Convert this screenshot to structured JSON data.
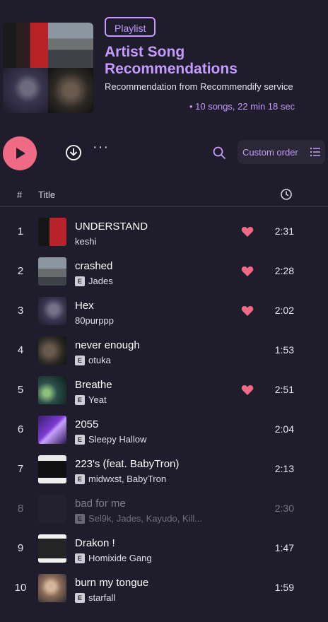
{
  "playlist": {
    "badge": "Playlist",
    "title": "Artist Song Recommendations",
    "subtitle": "Recommendation from Recommendify service",
    "meta": "• 10 songs, 22 min 18 sec"
  },
  "toolbar": {
    "sort_label": "Custom order"
  },
  "table": {
    "col_num": "#",
    "col_title": "Title"
  },
  "tracks": [
    {
      "num": "1",
      "title": "UNDERSTAND",
      "artist": "keshi",
      "explicit": false,
      "liked": true,
      "duration": "2:31",
      "dimmed": false
    },
    {
      "num": "2",
      "title": "crashed",
      "artist": "Jades",
      "explicit": true,
      "liked": true,
      "duration": "2:28",
      "dimmed": false
    },
    {
      "num": "3",
      "title": "Hex",
      "artist": "80purppp",
      "explicit": false,
      "liked": true,
      "duration": "2:02",
      "dimmed": false
    },
    {
      "num": "4",
      "title": "never enough",
      "artist": "otuka",
      "explicit": true,
      "liked": false,
      "duration": "1:53",
      "dimmed": false
    },
    {
      "num": "5",
      "title": "Breathe",
      "artist": "Yeat",
      "explicit": true,
      "liked": true,
      "duration": "2:51",
      "dimmed": false
    },
    {
      "num": "6",
      "title": "2055",
      "artist": "Sleepy Hallow",
      "explicit": true,
      "liked": false,
      "duration": "2:04",
      "dimmed": false
    },
    {
      "num": "7",
      "title": "223's (feat. BabyTron)",
      "artist": "midwxst, BabyTron",
      "explicit": true,
      "liked": false,
      "duration": "2:13",
      "dimmed": false
    },
    {
      "num": "8",
      "title": "bad for me",
      "artist": "Sel9k, Jades, Kayudo, Kill...",
      "explicit": true,
      "liked": false,
      "duration": "2:30",
      "dimmed": true
    },
    {
      "num": "9",
      "title": "Drakon !",
      "artist": "Homixide Gang",
      "explicit": true,
      "liked": false,
      "duration": "1:47",
      "dimmed": false
    },
    {
      "num": "10",
      "title": "burn my tongue",
      "artist": "starfall",
      "explicit": true,
      "liked": false,
      "duration": "1:59",
      "dimmed": false
    }
  ],
  "explicit_label": "E",
  "icons": {
    "play": "play-icon",
    "download": "download-icon",
    "more": "more-options-icon",
    "search": "search-icon",
    "sort": "list-icon",
    "duration": "clock-icon",
    "like": "heart-icon"
  },
  "colors": {
    "background": "#1f1d2b",
    "accent": "#c59bff",
    "play_button": "#f06a86",
    "heart": "#f06a86"
  }
}
